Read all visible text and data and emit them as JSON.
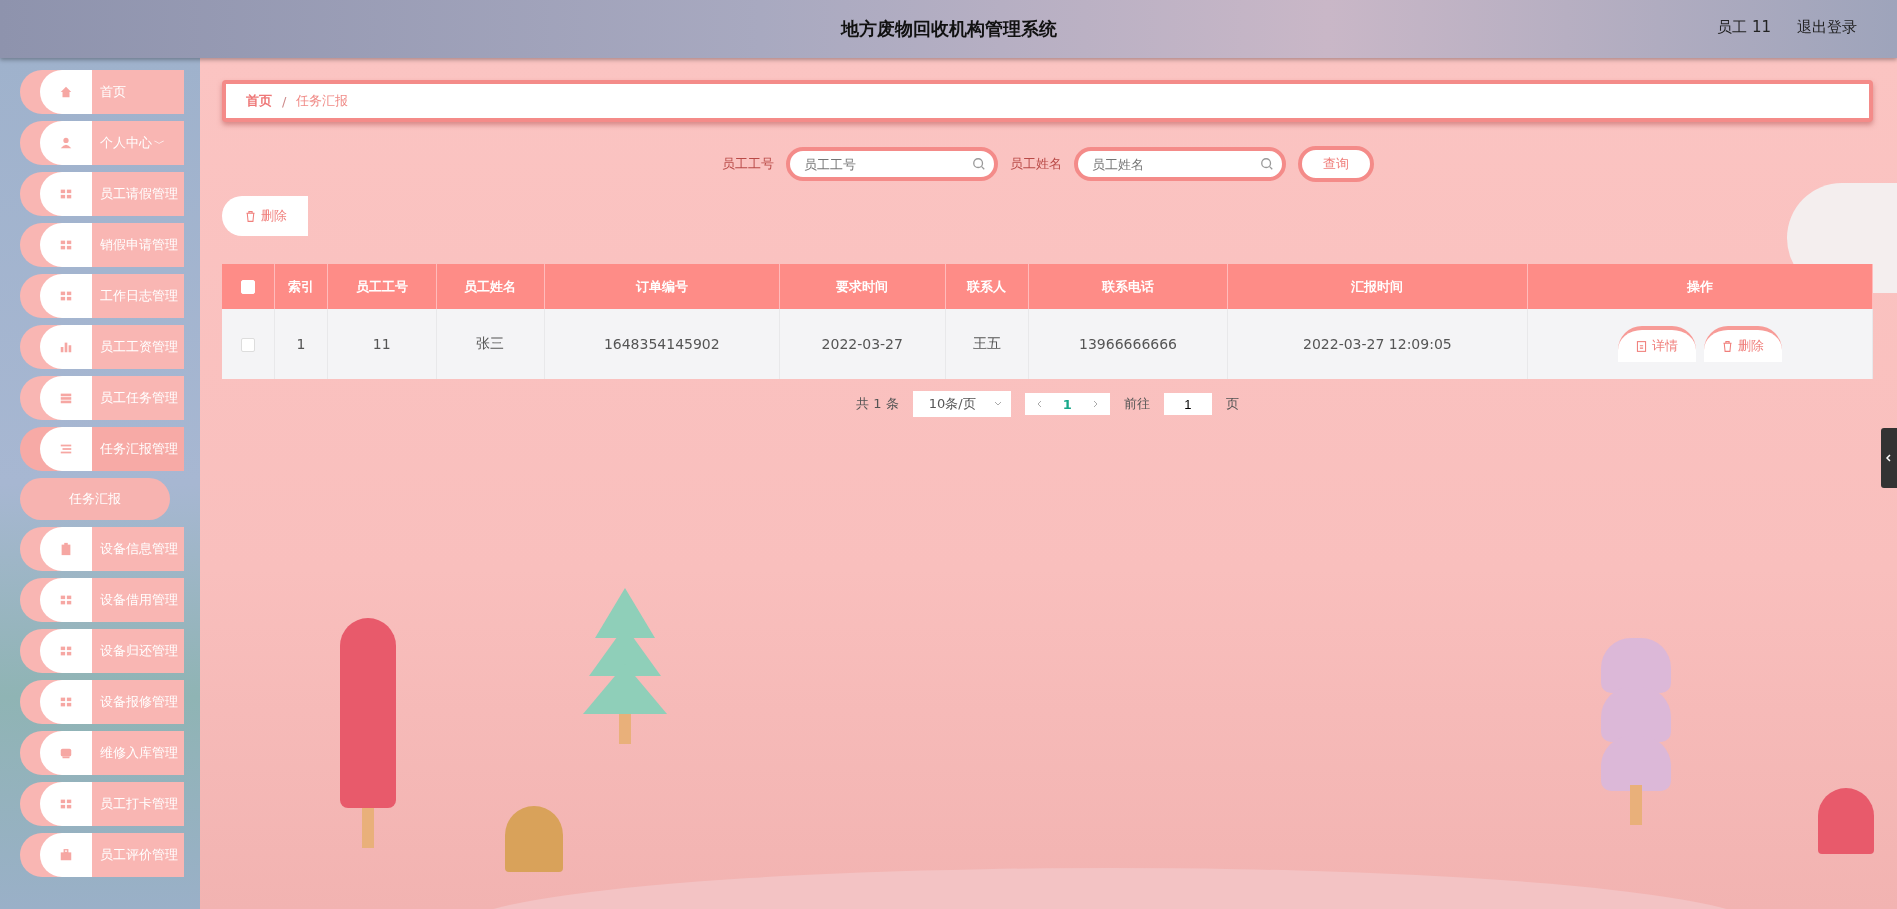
{
  "header": {
    "title": "地方废物回收机构管理系统",
    "user": "员工 11",
    "logout": "退出登录"
  },
  "sidebar": {
    "items": [
      {
        "label": "首页",
        "kind": "home",
        "expanded": false
      },
      {
        "label": "个人中心",
        "kind": "user",
        "expanded": false,
        "caret": "﹀"
      },
      {
        "label": "员工请假管理",
        "kind": "grid",
        "expanded": false
      },
      {
        "label": "销假申请管理",
        "kind": "grid",
        "expanded": false
      },
      {
        "label": "工作日志管理",
        "kind": "grid",
        "expanded": false
      },
      {
        "label": "员工工资管理",
        "kind": "chart",
        "expanded": false
      },
      {
        "label": "员工任务管理",
        "kind": "rows",
        "expanded": false
      },
      {
        "label": "任务汇报管理",
        "kind": "list",
        "expanded": true,
        "children": [
          {
            "label": "任务汇报",
            "selected": true
          }
        ]
      },
      {
        "label": "设备信息管理",
        "kind": "clipboard",
        "expanded": false
      },
      {
        "label": "设备借用管理",
        "kind": "grid",
        "expanded": false
      },
      {
        "label": "设备归还管理",
        "kind": "grid",
        "expanded": false
      },
      {
        "label": "设备报修管理",
        "kind": "grid",
        "expanded": false
      },
      {
        "label": "维修入库管理",
        "kind": "box",
        "expanded": false
      },
      {
        "label": "员工打卡管理",
        "kind": "grid",
        "expanded": false
      },
      {
        "label": "员工评价管理",
        "kind": "briefcase",
        "expanded": false
      }
    ]
  },
  "breadcrumb": [
    {
      "label": "首页",
      "selected": false
    },
    {
      "label": "任务汇报",
      "selected": true
    }
  ],
  "breadcrumb_separator": "/",
  "search": {
    "fields": [
      {
        "label": "员工工号",
        "placeholder": "员工工号"
      },
      {
        "label": "员工姓名",
        "placeholder": "员工姓名"
      }
    ],
    "button": "查询"
  },
  "toolbar": {
    "delete": "删除"
  },
  "table": {
    "header_checked": false,
    "columns": [
      "索引",
      "员工工号",
      "员工姓名",
      "订单编号",
      "要求时间",
      "联系人",
      "联系电话",
      "汇报时间",
      "操作"
    ],
    "rows": [
      {
        "checked": false,
        "cells": [
          "1",
          "11",
          "张三",
          "1648354145902",
          "2022-03-27",
          "王五",
          "13966666666",
          "2022-03-27 12:09:05"
        ],
        "actions": [
          "详情",
          "删除"
        ]
      }
    ]
  },
  "pagination": {
    "total": "共 1 条",
    "page_size": "10条/页",
    "pages": [
      {
        "label": "1",
        "selected": true
      }
    ],
    "goto_label": "前往",
    "goto_value": "1",
    "goto_suffix": "页"
  }
}
